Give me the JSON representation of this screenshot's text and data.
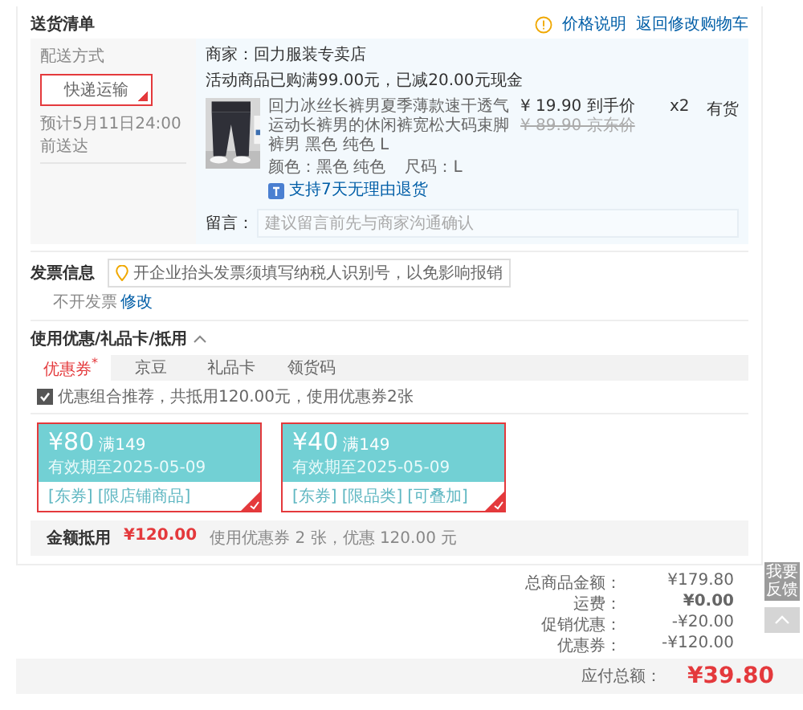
{
  "delivery": {
    "title": "送货清单",
    "price_note": "价格说明",
    "back_link": "返回修改购物车",
    "method_label": "配送方式",
    "options": [
      {
        "label": "快递运输",
        "selected": true
      }
    ],
    "eta": "预计5月11日24:00前送达",
    "shop": "商家：回力服装专卖店",
    "promo": "活动商品已购满99.00元，已减20.00元现金",
    "product": {
      "title": "回力冰丝长裤男夏季薄款速干透气运动长裤男的休闲裤宽松大码束脚裤男 黑色 纯色 L",
      "price": "¥ 19.90 到手价",
      "list_price": "¥ 89.90 京东价",
      "qty": "x2",
      "stock": "有货",
      "color_spec": "颜色：黑色 纯色",
      "size_spec": "尺码：L",
      "return_policy": "支持7天无理由退货"
    },
    "note_label": "留言：",
    "note_placeholder": "建议留言前先与商家沟通确认"
  },
  "invoice": {
    "title": "发票信息",
    "tip": "开企业抬头发票须填写纳税人识别号，以免影响报销",
    "status": "不开发票",
    "edit_link": "修改"
  },
  "discounts": {
    "title": "使用优惠/礼品卡/抵用",
    "expanded": true,
    "tabs": [
      {
        "label": "优惠券$^{*}$",
        "selected": true
      },
      {
        "label": "京豆",
        "selected": false
      },
      {
        "label": "礼品卡",
        "selected": false
      },
      {
        "label": "领货码",
        "selected": false
      }
    ],
    "combo": {
      "label": "优惠组合推荐，共抵用120.00元，使用优惠券2张",
      "checked": true
    },
    "coupons": [
      {
        "amount": "¥80",
        "condition": "满149",
        "validity": "有效期至2025-05-09",
        "tags": [
          "[东券]",
          "[限店铺商品]"
        ],
        "selected": true
      },
      {
        "amount": "¥40",
        "condition": "满149",
        "validity": "有效期至2025-05-09",
        "tags": [
          "[东券]",
          "[限品类]",
          "[可叠加]"
        ],
        "selected": true
      }
    ],
    "summary_label": "金额抵用",
    "summary_amount": "¥120.00",
    "summary_text": "使用优惠券 2 张，优惠 120.00 元"
  },
  "totals": [
    {
      "label": "总商品金额：",
      "value": "¥179.80",
      "bold": false
    },
    {
      "label": "运费：",
      "value": "¥0.00",
      "bold": true
    },
    {
      "label": "促销优惠：",
      "value": "-¥20.00",
      "bold": false
    },
    {
      "label": "优惠券：",
      "value": "-¥120.00",
      "bold": false
    }
  ],
  "payable": {
    "label": "应付总额：",
    "value": "¥39.80"
  },
  "side": {
    "feedback": "我要反馈"
  }
}
